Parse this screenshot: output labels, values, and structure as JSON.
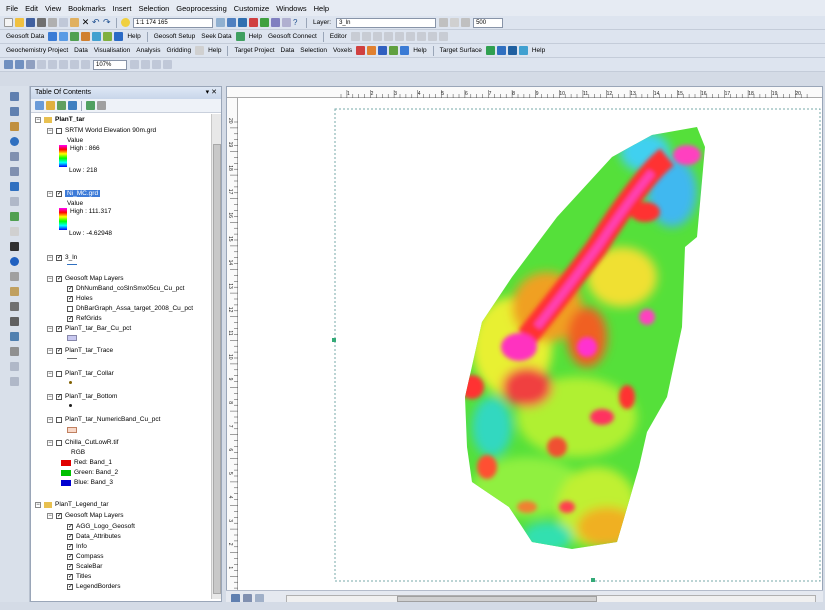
{
  "menu": [
    "File",
    "Edit",
    "View",
    "Bookmarks",
    "Insert",
    "Selection",
    "Geoprocessing",
    "Customize",
    "Windows",
    "Help"
  ],
  "toolbar1": {
    "scale": "1:1 174 165",
    "layer_label": "Layer:",
    "layer_value": "3_ln",
    "zoom_value": "500"
  },
  "toolbar2": {
    "geosoft_data": "Geosoft Data",
    "help": "Help",
    "geosoft_setup": "Geosoft Setup",
    "seek_data": "Seek Data",
    "help2": "Help",
    "geosoft_connect": "Geosoft Connect",
    "editor": "Editor"
  },
  "toolbar3": {
    "geochem": "Geochemistry Project",
    "data": "Data",
    "visualisation": "Visualisation",
    "analysis": "Analysis",
    "gridding": "Gridding",
    "help": "Help",
    "target_project": "Target Project",
    "data2": "Data",
    "selection": "Selection",
    "voxels": "Voxels",
    "help2": "Help",
    "target_surface": "Target Surface",
    "help3": "Help"
  },
  "toolbar4": {
    "zoom_percent": "107%"
  },
  "toc": {
    "title": "Table Of Contents",
    "items": [
      {
        "label": "PlanT_tar",
        "level": 0,
        "bold": true
      },
      {
        "label": "SRTM World Elevation 90m.grd",
        "level": 1,
        "checked": false
      },
      {
        "label": "Value",
        "level": 2
      },
      {
        "label": "High : 866",
        "level": 2
      },
      {
        "label": "Low : 218",
        "level": 2
      },
      {
        "label": "Ni_MC.grd",
        "level": 1,
        "checked": true,
        "selected": true
      },
      {
        "label": "Value",
        "level": 2
      },
      {
        "label": "High : 111.317",
        "level": 2
      },
      {
        "label": "Low : -4.62948",
        "level": 2
      },
      {
        "label": "3_ln",
        "level": 1,
        "checked": true
      },
      {
        "label": "Geosoft Map Layers",
        "level": 1,
        "checked": true
      },
      {
        "label": "DhNumBand_coSlnSmx05cu_Cu_pct",
        "level": 2,
        "checked": true
      },
      {
        "label": "Holes",
        "level": 2,
        "checked": true
      },
      {
        "label": "DhBarGraph_Assa_target_2008_Cu_pct",
        "level": 2,
        "checked": false
      },
      {
        "label": "RefGrids",
        "level": 2,
        "checked": true
      },
      {
        "label": "PlanT_tar_Bar_Cu_pct",
        "level": 1,
        "checked": true
      },
      {
        "label": "PlanT_tar_Trace",
        "level": 1,
        "checked": true
      },
      {
        "label": "PlanT_tar_Collar",
        "level": 1,
        "checked": false
      },
      {
        "label": "PlanT_tar_Bottom",
        "level": 1,
        "checked": true
      },
      {
        "label": "PlanT_tar_NumericBand_Cu_pct",
        "level": 1,
        "checked": false
      },
      {
        "label": "Chilla_CutLowR.tif",
        "level": 1,
        "checked": false
      },
      {
        "label": "RGB",
        "level": 2
      },
      {
        "label": "Red:  Band_1",
        "level": 2
      },
      {
        "label": "Green: Band_2",
        "level": 2
      },
      {
        "label": "Blue:  Band_3",
        "level": 2
      },
      {
        "label": "PlanT_Legend_tar",
        "level": 0,
        "bold": false
      },
      {
        "label": "Geosoft Map Layers",
        "level": 1,
        "checked": true
      },
      {
        "label": "AGG_Logo_Geosoft",
        "level": 2,
        "checked": true
      },
      {
        "label": "Data_Attributes",
        "level": 2,
        "checked": true
      },
      {
        "label": "Info",
        "level": 2,
        "checked": true
      },
      {
        "label": "Compass",
        "level": 2,
        "checked": true
      },
      {
        "label": "ScaleBar",
        "level": 2,
        "checked": true
      },
      {
        "label": "Titles",
        "level": 2,
        "checked": true
      },
      {
        "label": "LegendBorders",
        "level": 2,
        "checked": true
      }
    ]
  },
  "ruler_ticks": [
    "1",
    "2",
    "3",
    "4",
    "5",
    "6",
    "7",
    "8",
    "9",
    "10",
    "11",
    "12",
    "13",
    "14",
    "15",
    "16",
    "17",
    "18",
    "19",
    "20"
  ],
  "ruler_v_ticks": [
    "20",
    "19",
    "18",
    "17",
    "16",
    "15",
    "14",
    "13",
    "12",
    "11",
    "10",
    "9",
    "8",
    "7",
    "6",
    "5",
    "4",
    "3",
    "2",
    "1"
  ],
  "colors": {
    "selected": "#3d7bd8",
    "accent": "#dde4ef"
  }
}
